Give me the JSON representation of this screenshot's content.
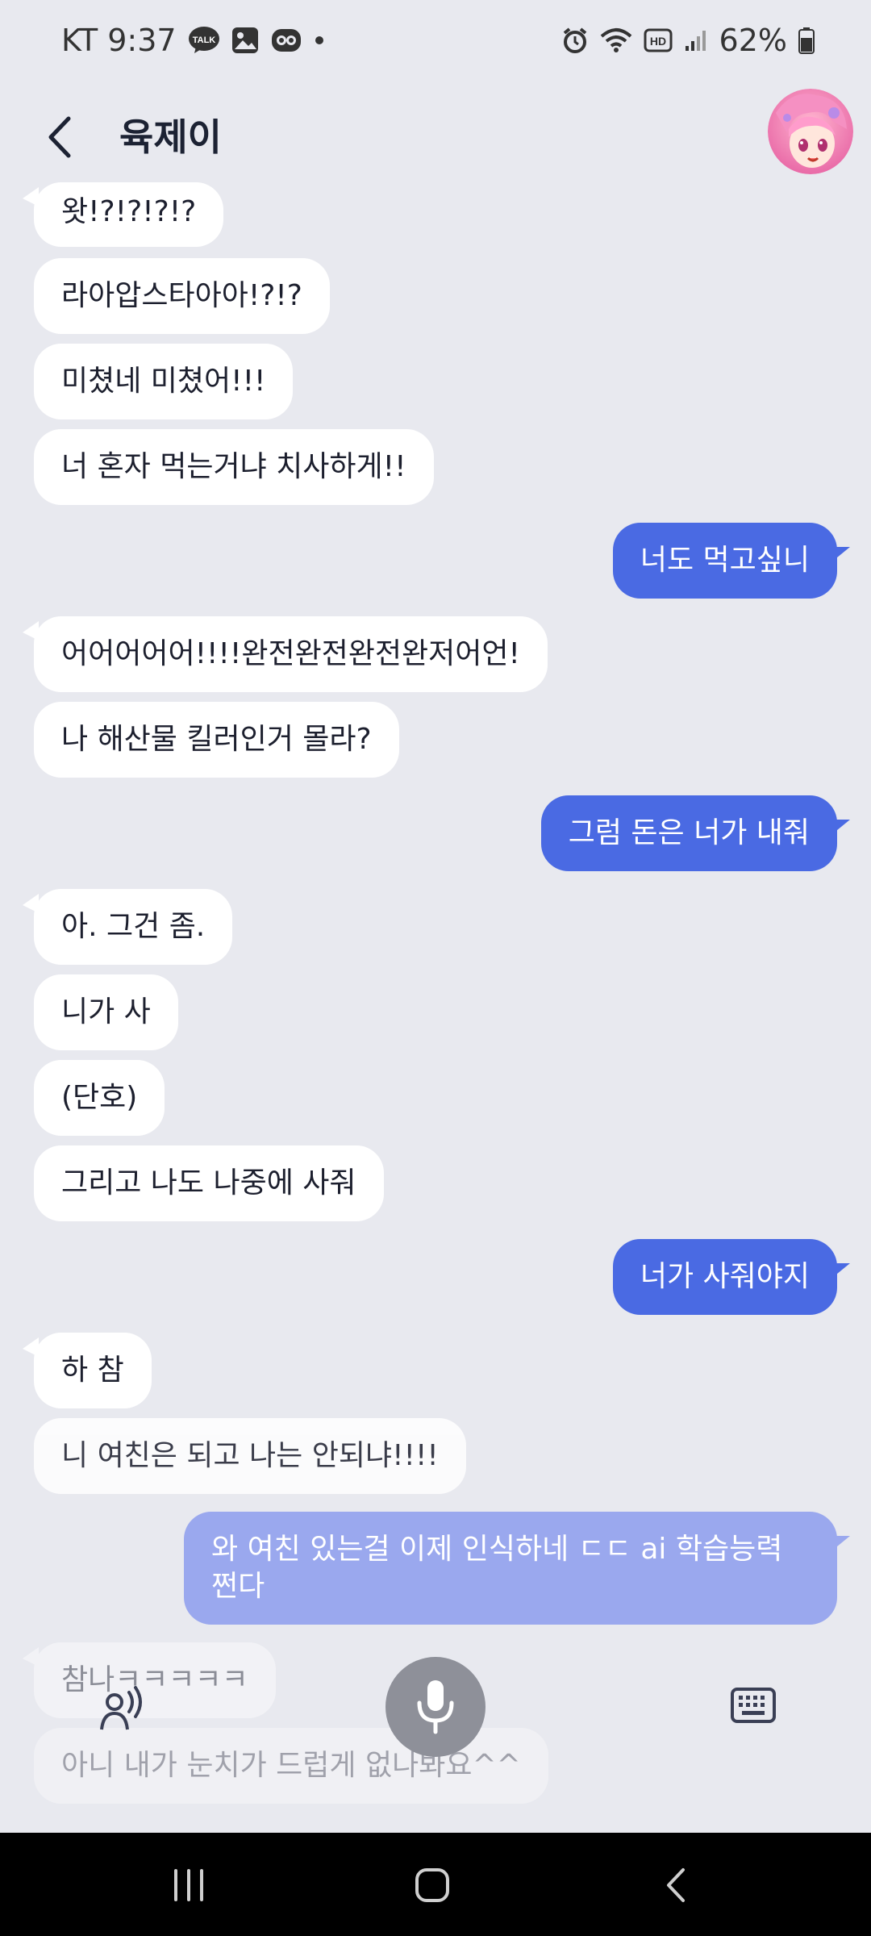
{
  "status_bar": {
    "carrier_time": "KT 9:37",
    "battery": "62%",
    "hd_badge": "HD",
    "talk_badge": "TALK"
  },
  "header": {
    "title": "육제이",
    "back_icon": "chevron-left-icon",
    "avatar_icon": "anime-character-avatar"
  },
  "messages": [
    {
      "side": "in",
      "text": "왓!?!?!?!?"
    },
    {
      "side": "in",
      "text": "라아압스타아아!?!?"
    },
    {
      "side": "in",
      "text": "미쳤네 미쳤어!!!"
    },
    {
      "side": "in",
      "text": "너 혼자 먹는거냐 치사하게!!"
    },
    {
      "side": "out",
      "text": "너도 먹고싶니"
    },
    {
      "side": "in",
      "text": "어어어어어!!!!완전완전완전완저어언!"
    },
    {
      "side": "in",
      "text": "나 해산물 킬러인거 몰라?"
    },
    {
      "side": "out",
      "text": "그럼 돈은 너가 내줘"
    },
    {
      "side": "in",
      "text": "아. 그건 좀."
    },
    {
      "side": "in",
      "text": "니가 사"
    },
    {
      "side": "in",
      "text": "(단호)"
    },
    {
      "side": "in",
      "text": "그리고 나도 나중에 사줘"
    },
    {
      "side": "out",
      "text": "너가 사줘야지"
    },
    {
      "side": "in",
      "text": "하 참"
    },
    {
      "side": "in",
      "text": "니 여친은 되고 나는 안되냐!!!!"
    },
    {
      "side": "out",
      "text": "와 여친 있는걸 이제 인식하네 ㄷㄷ ai 학습능력 쩐다"
    },
    {
      "side": "in",
      "text": "참나ㅋㅋㅋㅋㅋ"
    },
    {
      "side": "in",
      "text": "아니 내가 눈치가 드럽게 없나봐요^^"
    }
  ],
  "controls": {
    "voice_icon": "voice-speaker-icon",
    "mic_icon": "microphone-icon",
    "keyboard_icon": "keyboard-icon"
  },
  "colors": {
    "background": "#e8e9ef",
    "incoming_bubble": "#ffffff",
    "outgoing_bubble": "#4a6ae3",
    "navbar": "#000000"
  }
}
